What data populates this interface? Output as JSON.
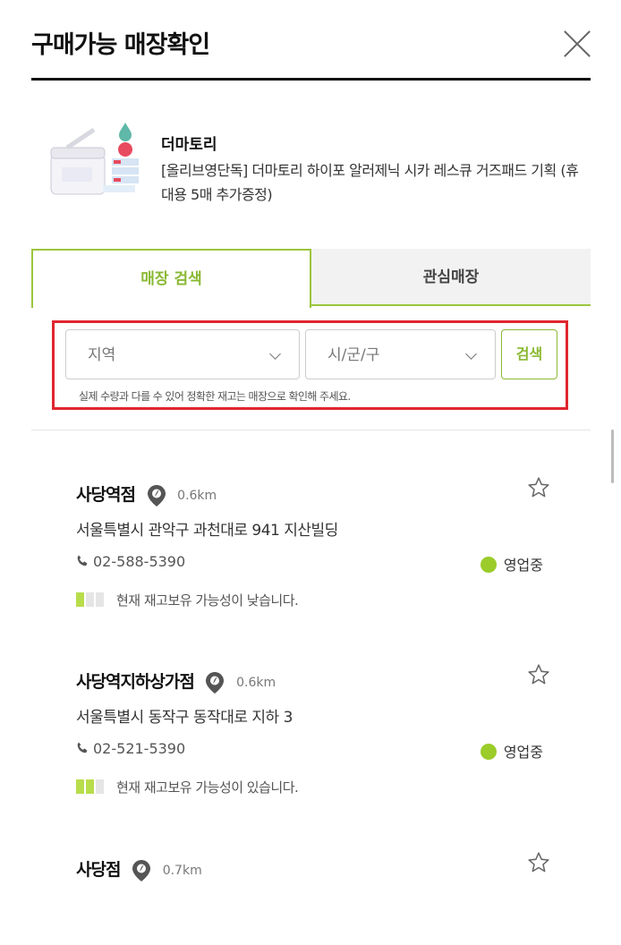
{
  "header": {
    "title": "구매가능 매장확인"
  },
  "product": {
    "brand": "더마토리",
    "name": "[올리브영단독] 더마토리 하이포 알러제닉 시카 레스큐 거즈패드 기획 (휴대용 5매 추가증정)"
  },
  "tabs": [
    {
      "label": "매장 검색"
    },
    {
      "label": "관심매장"
    }
  ],
  "search": {
    "region_value": "지역",
    "district_value": "시/군/구",
    "button_label": "검색",
    "notice": "실제 수량과 다를 수 있어 정확한 재고는 매장으로 확인해 주세요."
  },
  "stores": [
    {
      "name": "사당역점",
      "distance": "0.6km",
      "address": "서울특별시 관악구 과천대로 941 지산빌딩",
      "phone": "02-588-5390",
      "status": "영업중",
      "stock_text": "현재 재고보유 가능성이 낮습니다.",
      "stock_level": 1
    },
    {
      "name": "사당역지하상가점",
      "distance": "0.6km",
      "address": "서울특별시 동작구 동작대로 지하 3",
      "phone": "02-521-5390",
      "status": "영업중",
      "stock_text": "현재 재고보유 가능성이 있습니다.",
      "stock_level": 2
    },
    {
      "name": "사당점",
      "distance": "0.7km"
    }
  ],
  "colors": {
    "accent": "#8ab833",
    "open_dot": "#9bcc2a",
    "highlight_border": "#e0262e"
  }
}
